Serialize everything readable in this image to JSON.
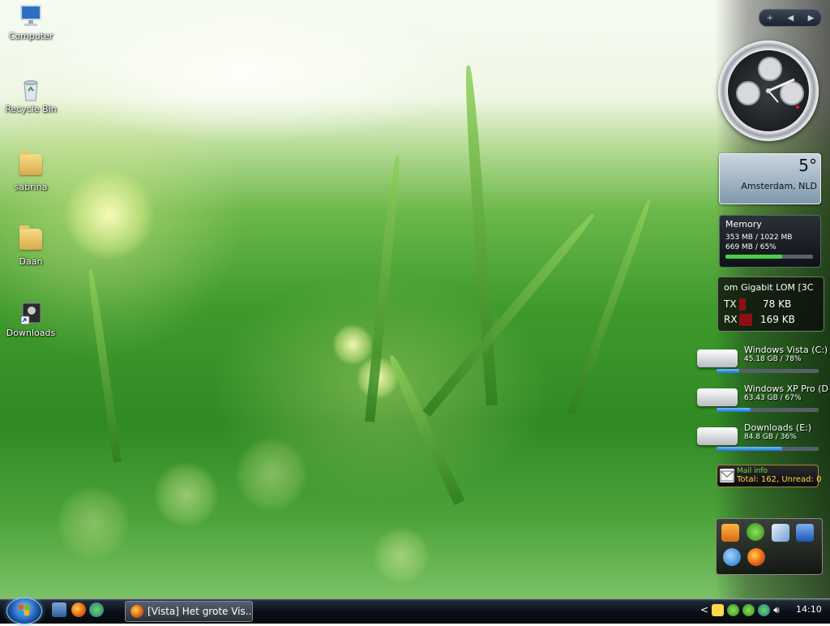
{
  "desktop": {
    "icons": [
      {
        "label": "Computer",
        "icon": "computer-icon"
      },
      {
        "label": "Recycle Bin",
        "icon": "recycle-bin-icon"
      },
      {
        "label": "sabrina",
        "icon": "folder-icon"
      },
      {
        "label": "Daan",
        "icon": "folder-icon"
      },
      {
        "label": "Downloads",
        "icon": "downloads-icon"
      }
    ]
  },
  "sidebar": {
    "controls": [
      "+",
      "◀",
      "▶"
    ],
    "weather": {
      "temp": "5°",
      "city": "Amsterdam, NLD"
    },
    "memory": {
      "title": "Memory",
      "line1": "353 MB / 1022 MB",
      "line2": "669 MB / 65%",
      "usage": 0.65
    },
    "network": {
      "adapter": "om Gigabit LOM [3C",
      "tx_label": "TX",
      "tx_value": "78 KB",
      "rx_label": "RX",
      "rx_value": "169 KB"
    },
    "drives": [
      {
        "name": "Windows Vista (C:)",
        "size": "45.18 GB / 78%",
        "fill": 0.22
      },
      {
        "name": "Windows XP Pro (D",
        "size": "63.43 GB / 67%",
        "fill": 0.33
      },
      {
        "name": "Downloads (E:)",
        "size": "84.8 GB / 36%",
        "fill": 0.64
      }
    ],
    "mail": {
      "title": "Mail info",
      "summary": "Total: 162, Unread: 0"
    }
  },
  "taskbar": {
    "window_title": "[Vista] Het grote Vis...",
    "time": "14:10",
    "tray_arrow": "<"
  },
  "colors": {
    "accent": "#1b5fb7",
    "memory_bar": "#47d14a",
    "net_bar": "#8b0f14",
    "drive_fill": "#1f6fd6"
  }
}
